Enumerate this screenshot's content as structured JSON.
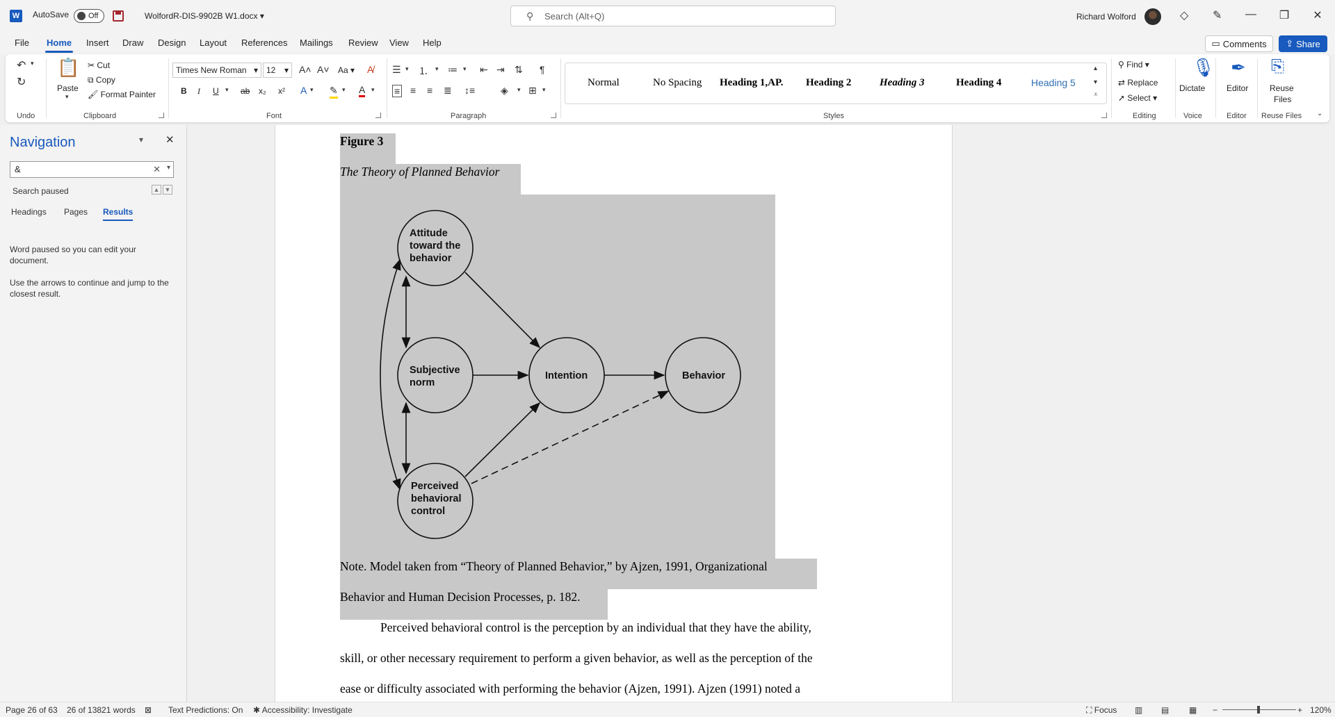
{
  "titlebar": {
    "logo": "W",
    "autosave_label": "AutoSave",
    "autosave_state": "Off",
    "doc_name": "WolfordR-DIS-9902B W1.docx",
    "search_placeholder": "Search (Alt+Q)",
    "user_name": "Richard Wolford"
  },
  "menu": {
    "tabs": [
      "File",
      "Home",
      "Insert",
      "Draw",
      "Design",
      "Layout",
      "References",
      "Mailings",
      "Review",
      "View",
      "Help"
    ],
    "comments": "Comments",
    "share": "Share"
  },
  "ribbon": {
    "groups": {
      "undo": "Undo",
      "clipboard": "Clipboard",
      "font": "Font",
      "paragraph": "Paragraph",
      "styles": "Styles",
      "editing": "Editing",
      "voice": "Voice",
      "editor": "Editor",
      "reuse_files": "Reuse Files"
    },
    "clipboard": {
      "paste": "Paste",
      "cut": "Cut",
      "copy": "Copy",
      "format_painter": "Format Painter"
    },
    "font": {
      "name": "Times New Roman",
      "size": "12",
      "bold": "B",
      "italic": "I",
      "underline": "U",
      "strike": "ab",
      "subscript": "x₂",
      "superscript": "x²",
      "change_case": "Aa"
    },
    "styles": [
      "Normal",
      "No Spacing",
      "Heading 1,AP.",
      "Heading 2",
      "Heading 3",
      "Heading 4",
      "Heading 5"
    ],
    "editing": {
      "find": "Find",
      "replace": "Replace",
      "select": "Select"
    },
    "voice": {
      "dictate": "Dictate"
    },
    "editor": {
      "editor": "Editor"
    },
    "reuse": {
      "line1": "Reuse",
      "line2": "Files"
    }
  },
  "navigation": {
    "title": "Navigation",
    "search_value": "&",
    "status": "Search paused",
    "tabs": [
      "Headings",
      "Pages",
      "Results"
    ],
    "active_tab": "Results",
    "message1_line1": "Word paused so you can edit your",
    "message1_line2": "document.",
    "message2_line1": "Use the arrows to continue and jump to the",
    "message2_line2": "closest result."
  },
  "document": {
    "figure_label": "Figure 3",
    "figure_title": "The Theory of Planned Behavior",
    "diagram": {
      "nodes": {
        "attitude": [
          "Attitude",
          "toward the",
          "behavior"
        ],
        "subjective": [
          "Subjective",
          "norm"
        ],
        "perceived": [
          "Perceived",
          "behavioral",
          "control"
        ],
        "intention": [
          "Intention"
        ],
        "behavior": [
          "Behavior"
        ]
      }
    },
    "note_line1": "Note.  Model taken from “Theory of Planned Behavior,” by Ajzen, 1991, Organizational",
    "note_line2": "Behavior and Human Decision Processes, p. 182.",
    "body_line1": "Perceived behavioral control is the perception by an individual that they have the ability,",
    "body_line2": "skill, or other necessary requirement to perform a given behavior, as well as the perception of the",
    "body_line3": "ease or difficulty associated with performing the behavior (Ajzen, 1991).  Ajzen (1991) noted a"
  },
  "statusbar": {
    "page": "Page 26 of 63",
    "words": "26 of 13821 words",
    "text_predictions": "Text Predictions: On",
    "accessibility": "Accessibility: Investigate",
    "focus": "Focus",
    "zoom": "120%"
  },
  "colors": {
    "accent": "#185abd",
    "highlight": "#c8c8c8"
  }
}
